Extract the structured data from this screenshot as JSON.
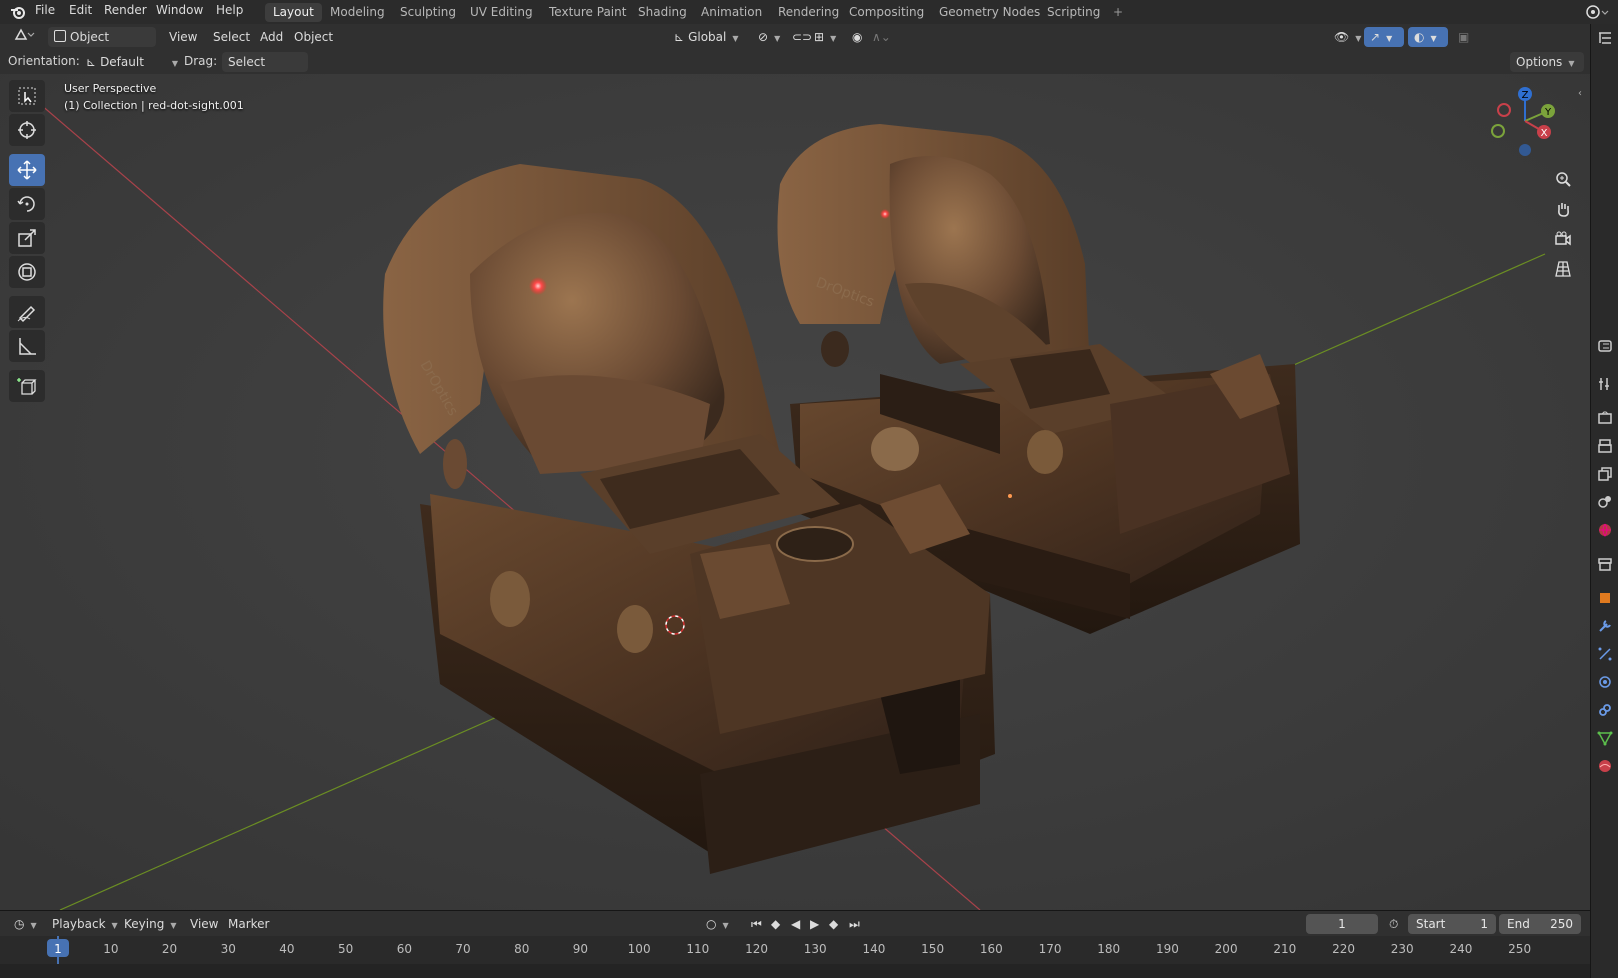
{
  "topbar": {
    "menu": [
      "File",
      "Edit",
      "Render",
      "Window",
      "Help"
    ],
    "workspaces": [
      {
        "label": "Layout",
        "active": true
      },
      {
        "label": "Modeling",
        "active": false
      },
      {
        "label": "Sculpting",
        "active": false
      },
      {
        "label": "UV Editing",
        "active": false
      },
      {
        "label": "Texture Paint",
        "active": false
      },
      {
        "label": "Shading",
        "active": false
      },
      {
        "label": "Animation",
        "active": false
      },
      {
        "label": "Rendering",
        "active": false
      },
      {
        "label": "Compositing",
        "active": false
      },
      {
        "label": "Geometry Nodes",
        "active": false
      },
      {
        "label": "Scripting",
        "active": false
      }
    ],
    "add_tab": "+"
  },
  "header": {
    "mode": "Object Mode",
    "menus": [
      "View",
      "Select",
      "Add",
      "Object"
    ],
    "transform_orientation": "Global",
    "options": "Options"
  },
  "toolsettings": {
    "orientation_label": "Orientation:",
    "orientation_value": "Default",
    "drag_label": "Drag:",
    "drag_value": "Select Box"
  },
  "viewport": {
    "view_name": "User Perspective",
    "collection_info": "(1) Collection | red-dot-sight.001",
    "model_engraving": "DrOptics",
    "gizmo": {
      "x": "X",
      "y": "Y",
      "z": "Z"
    }
  },
  "timeline": {
    "menus": [
      "Playback",
      "Keying",
      "View",
      "Marker"
    ],
    "current_frame": "1",
    "start_label": "Start",
    "start_value": "1",
    "end_label": "End",
    "end_value": "250",
    "ruler_ticks": [
      "1",
      "10",
      "20",
      "30",
      "40",
      "50",
      "60",
      "70",
      "80",
      "90",
      "100",
      "110",
      "120",
      "130",
      "140",
      "150",
      "160",
      "170",
      "180",
      "190",
      "200",
      "210",
      "220",
      "230",
      "240",
      "250"
    ]
  },
  "colors": {
    "accent": "#4772b3",
    "viewport_bg": "#3b3b3b",
    "header_bg": "#303030",
    "x_axis": "#a8424a",
    "y_axis": "#6b8e23",
    "z_axis": "#2f6fd1"
  }
}
